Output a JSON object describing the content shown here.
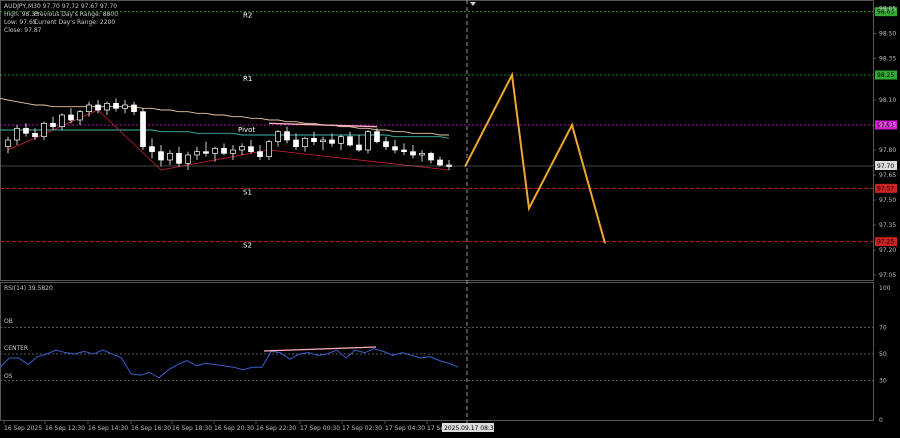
{
  "header": {
    "symbol_line": "AUDJPY,M30  97.70 97.72 97.67 97.70",
    "high": "High: 98.33",
    "prev_range": "Previous Day's Range: 8800",
    "low": "Low: 97.65",
    "current_range": "Current Day's Range: 2200",
    "close": "Close: 97.87"
  },
  "levels": [
    {
      "name": "R2",
      "price": 98.63,
      "tag": "98.63",
      "color": "#33aa33",
      "dash": "2,2"
    },
    {
      "name": "R1",
      "price": 98.25,
      "tag": "98.25",
      "color": "#33aa33",
      "dash": "2,2"
    },
    {
      "name": "Pivot",
      "price": 97.95,
      "tag": "97.95",
      "color": "#d020d0",
      "dash": "2,2"
    },
    {
      "name": "S1",
      "price": 97.57,
      "tag": "97.57",
      "color": "#cc2222",
      "dash": "4,2"
    },
    {
      "name": "S2",
      "price": 97.25,
      "tag": "97.25",
      "color": "#cc2222",
      "dash": "4,2"
    }
  ],
  "current_price": "97.70",
  "price_axis": [
    "98.65",
    "98.50",
    "98.35",
    "98.10",
    "97.95",
    "97.80",
    "97.65",
    "97.50",
    "97.35",
    "97.20",
    "97.05"
  ],
  "rsi": {
    "title": "RSI(14) 39.5820",
    "ob": "OB",
    "center": "CENTER",
    "os": "OS",
    "axis": [
      "100",
      "70",
      "50",
      "30",
      "0"
    ],
    "values": [
      40,
      47,
      47,
      42,
      48,
      50,
      53,
      51,
      50,
      52,
      50,
      53,
      50,
      47,
      35,
      34,
      36,
      32,
      38,
      42,
      45,
      41,
      43,
      42,
      41,
      40,
      38,
      40,
      40,
      52,
      51,
      46,
      50,
      51,
      49,
      50,
      53,
      47,
      53,
      51,
      54,
      52,
      49,
      51,
      49,
      47,
      48,
      45,
      43,
      40
    ]
  },
  "time_axis": [
    "16 Sep 2025",
    "16 Sep 12:30",
    "16 Sep 14:30",
    "16 Sep 16:30",
    "16 Sep 18:30",
    "16 Sep 20:30",
    "16 Sep 22:30",
    "17 Sep 00:30",
    "17 Sep 02:30",
    "17 Sep 04:30",
    "17 Se"
  ],
  "crosshair_time": "2025.09.17 08:30",
  "candles": [
    [
      97.82,
      97.88,
      97.78,
      97.86
    ],
    [
      97.86,
      97.95,
      97.83,
      97.93
    ],
    [
      97.93,
      97.96,
      97.88,
      97.9
    ],
    [
      97.9,
      97.93,
      97.86,
      97.88
    ],
    [
      97.88,
      97.97,
      97.86,
      97.96
    ],
    [
      97.96,
      98.0,
      97.92,
      97.94
    ],
    [
      97.94,
      98.02,
      97.92,
      98.01
    ],
    [
      98.01,
      98.05,
      97.96,
      97.98
    ],
    [
      97.98,
      98.04,
      97.95,
      98.03
    ],
    [
      98.03,
      98.09,
      98.0,
      98.07
    ],
    [
      98.07,
      98.1,
      98.02,
      98.04
    ],
    [
      98.04,
      98.09,
      98.01,
      98.08
    ],
    [
      98.08,
      98.11,
      98.03,
      98.05
    ],
    [
      98.05,
      98.1,
      98.02,
      98.07
    ],
    [
      98.07,
      98.09,
      98.01,
      98.03
    ],
    [
      98.03,
      98.05,
      97.8,
      97.82
    ],
    [
      97.82,
      97.87,
      97.75,
      97.79
    ],
    [
      97.79,
      97.83,
      97.7,
      97.74
    ],
    [
      97.74,
      97.8,
      97.71,
      97.78
    ],
    [
      97.78,
      97.82,
      97.7,
      97.72
    ],
    [
      97.72,
      97.79,
      97.68,
      97.77
    ],
    [
      97.77,
      97.82,
      97.74,
      97.79
    ],
    [
      97.79,
      97.85,
      97.76,
      97.78
    ],
    [
      97.78,
      97.82,
      97.73,
      97.81
    ],
    [
      97.81,
      97.84,
      97.77,
      97.78
    ],
    [
      97.78,
      97.83,
      97.74,
      97.8
    ],
    [
      97.8,
      97.84,
      97.77,
      97.82
    ],
    [
      97.82,
      97.86,
      97.78,
      97.79
    ],
    [
      97.79,
      97.83,
      97.74,
      97.76
    ],
    [
      97.76,
      97.86,
      97.74,
      97.85
    ],
    [
      97.85,
      97.92,
      97.82,
      97.91
    ],
    [
      97.91,
      97.94,
      97.84,
      97.86
    ],
    [
      97.86,
      97.9,
      97.8,
      97.82
    ],
    [
      97.82,
      97.88,
      97.79,
      97.87
    ],
    [
      97.87,
      97.91,
      97.83,
      97.85
    ],
    [
      97.85,
      97.88,
      97.8,
      97.86
    ],
    [
      97.86,
      97.9,
      97.82,
      97.84
    ],
    [
      97.84,
      97.89,
      97.8,
      97.88
    ],
    [
      97.88,
      97.91,
      97.82,
      97.83
    ],
    [
      97.83,
      97.89,
      97.79,
      97.8
    ],
    [
      97.8,
      97.92,
      97.78,
      97.91
    ],
    [
      97.91,
      97.93,
      97.84,
      97.85
    ],
    [
      97.85,
      97.88,
      97.8,
      97.82
    ],
    [
      97.82,
      97.86,
      97.78,
      97.8
    ],
    [
      97.8,
      97.84,
      97.77,
      97.79
    ],
    [
      97.79,
      97.83,
      97.75,
      97.77
    ],
    [
      97.77,
      97.8,
      97.73,
      97.78
    ],
    [
      97.78,
      97.79,
      97.72,
      97.74
    ],
    [
      97.74,
      97.76,
      97.7,
      97.71
    ],
    [
      97.71,
      97.74,
      97.68,
      97.7
    ]
  ],
  "ma_slow": [
    98.1,
    98.09,
    98.08,
    98.07,
    98.07,
    98.06,
    98.06,
    98.06,
    98.06,
    98.06,
    98.06,
    98.06,
    98.06,
    98.06,
    98.06,
    98.05,
    98.05,
    98.04,
    98.04,
    98.03,
    98.03,
    98.02,
    98.02,
    98.01,
    98.01,
    98.0,
    98.0,
    97.99,
    97.99,
    97.98,
    97.98,
    97.97,
    97.97,
    97.96,
    97.96,
    97.95,
    97.95,
    97.94,
    97.94,
    97.93,
    97.93,
    97.92,
    97.92,
    97.91,
    97.91,
    97.9,
    97.9,
    97.9,
    97.89,
    97.89
  ],
  "ma_fast": [
    97.92,
    97.92,
    97.92,
    97.92,
    97.92,
    97.92,
    97.92,
    97.92,
    97.92,
    97.92,
    97.92,
    97.92,
    97.92,
    97.92,
    97.92,
    97.92,
    97.92,
    97.91,
    97.91,
    97.91,
    97.91,
    97.9,
    97.9,
    97.9,
    97.9,
    97.9,
    97.89,
    97.89,
    97.89,
    97.89,
    97.89,
    97.89,
    97.89,
    97.89,
    97.89,
    97.89,
    97.89,
    97.89,
    97.89,
    97.89,
    97.89,
    97.89,
    97.89,
    97.88,
    97.88,
    97.88,
    97.88,
    97.88,
    97.88,
    97.87
  ],
  "trend_lines": [
    {
      "color": "#cc2233",
      "points": [
        [
          0,
          97.8
        ],
        [
          10,
          98.04
        ],
        [
          17,
          97.68
        ],
        [
          29,
          97.8
        ]
      ]
    },
    {
      "color": "#cc2233",
      "points": [
        [
          29,
          97.8
        ],
        [
          49,
          97.68
        ]
      ]
    },
    {
      "color": "#ffb0c0",
      "points": [
        [
          29,
          97.96
        ],
        [
          41,
          97.94
        ]
      ]
    }
  ],
  "forecast": {
    "color": "#f0a830",
    "points": [
      [
        97.7
      ],
      [
        98.25
      ],
      [
        97.45
      ],
      [
        97.95
      ],
      [
        97.24
      ]
    ]
  },
  "colors": {
    "up": "#000000",
    "down": "#ffffff",
    "wick": "#ffffff",
    "ma_slow": "#e8c8a0",
    "ma_fast": "#3cb8a8",
    "rsi": "#3a5fd0",
    "grid": "#666666"
  }
}
